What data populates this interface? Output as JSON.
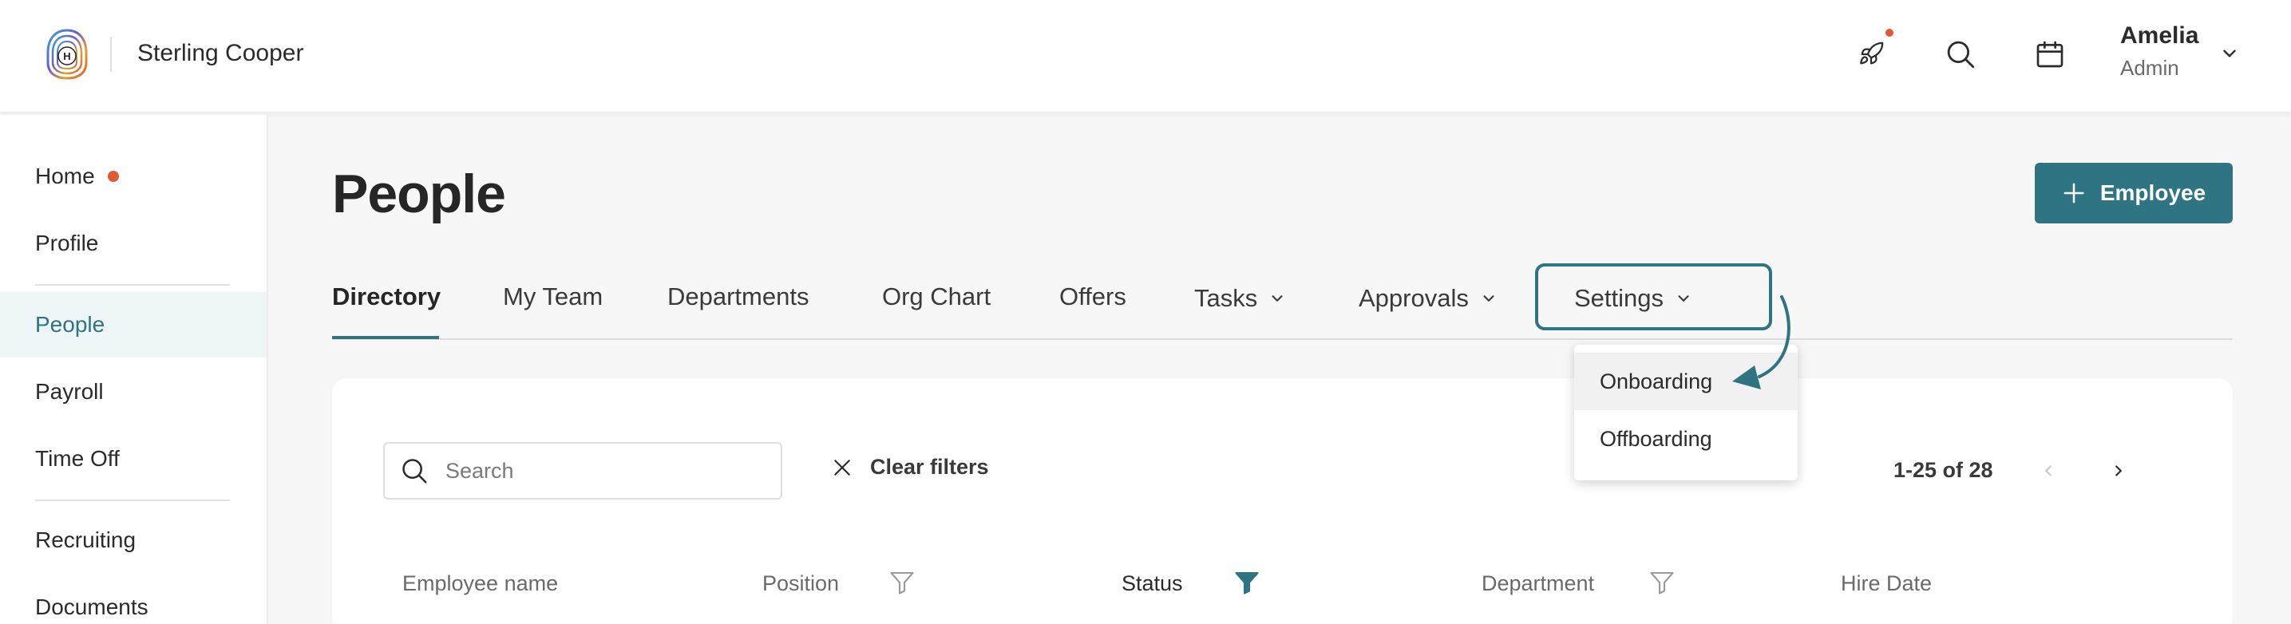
{
  "header": {
    "brand_name": "Sterling Cooper",
    "logo_letter": "H",
    "icons": [
      "rocket-icon",
      "search-icon",
      "calendar-icon"
    ],
    "user": {
      "name": "Amelia",
      "role": "Admin"
    }
  },
  "sidebar": {
    "items": [
      {
        "label": "Home",
        "has_dot": true
      },
      {
        "label": "Profile"
      },
      {
        "label": "People",
        "active": true
      },
      {
        "label": "Payroll"
      },
      {
        "label": "Time Off"
      },
      {
        "label": "Recruiting"
      },
      {
        "label": "Documents"
      }
    ]
  },
  "main": {
    "title": "People",
    "add_button_label": "Employee",
    "tabs": [
      {
        "label": "Directory",
        "active": true
      },
      {
        "label": "My Team"
      },
      {
        "label": "Departments"
      },
      {
        "label": "Org Chart"
      },
      {
        "label": "Offers"
      },
      {
        "label": "Tasks",
        "has_chevron": true
      },
      {
        "label": "Approvals",
        "has_chevron": true
      },
      {
        "label": "Settings",
        "has_chevron": true,
        "focused": true
      }
    ],
    "settings_dropdown": {
      "items": [
        "Onboarding",
        "Offboarding"
      ],
      "hovered": "Onboarding"
    }
  },
  "table": {
    "search_placeholder": "Search",
    "clear_filters_label": "Clear filters",
    "pagination_text": "1-25 of 28",
    "columns": [
      {
        "label": "Employee name"
      },
      {
        "label": "Position",
        "filter": "inactive"
      },
      {
        "label": "Status",
        "filter": "active"
      },
      {
        "label": "Department",
        "filter": "inactive"
      },
      {
        "label": "Hire Date"
      }
    ]
  },
  "colors": {
    "accent": "#2f7482",
    "notification": "#e05a34",
    "background": "#f7f7f7"
  }
}
